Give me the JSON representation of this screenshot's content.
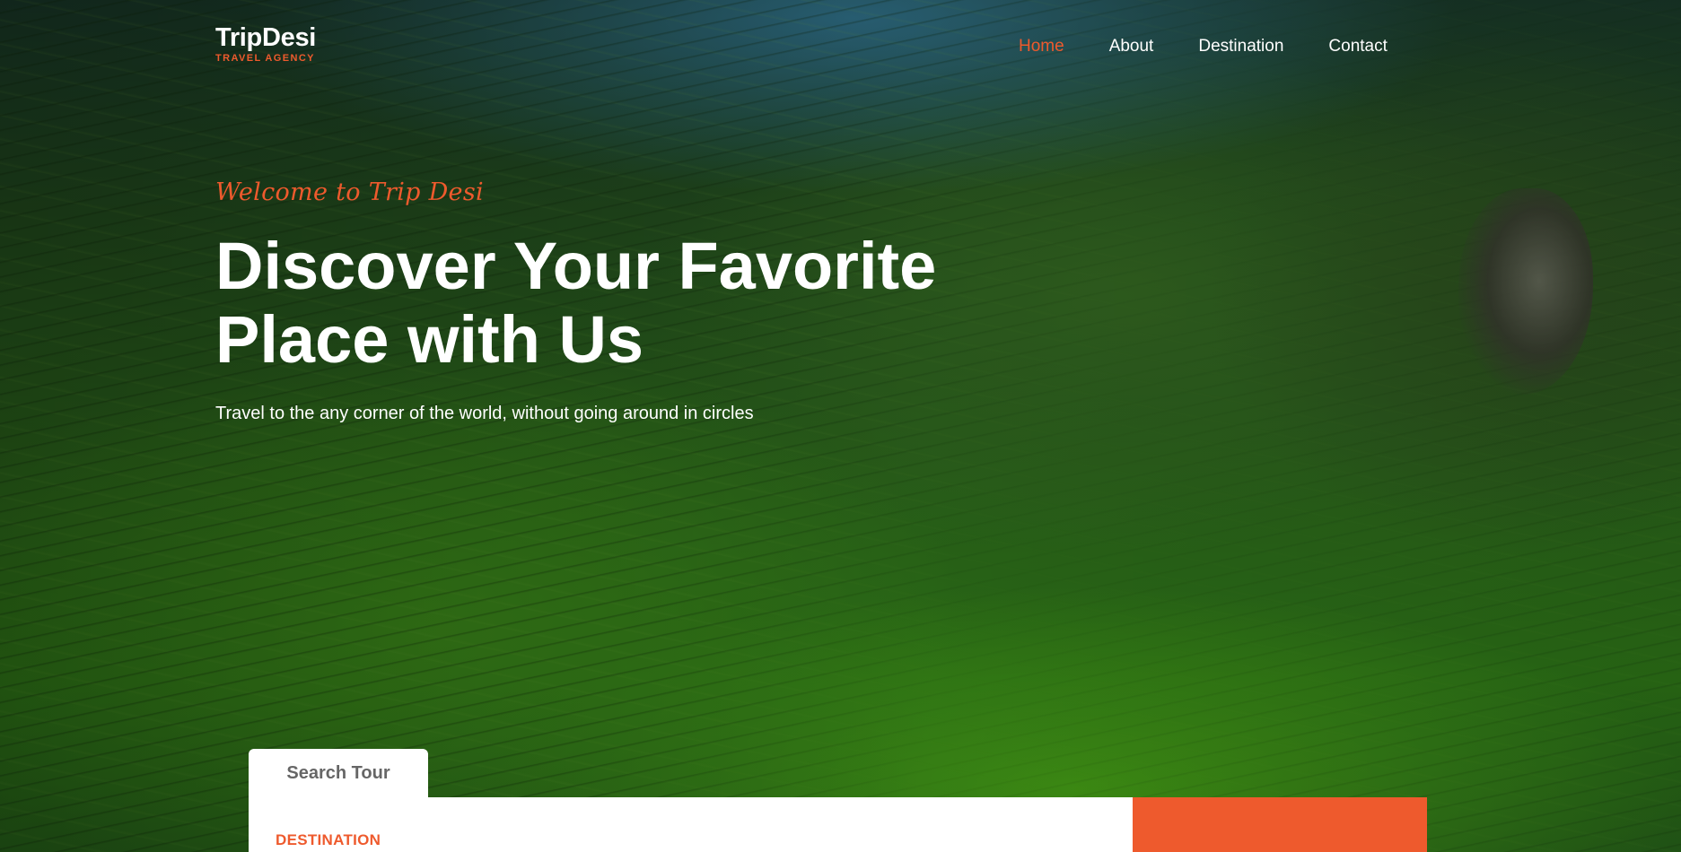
{
  "brand": {
    "name": "TripDesi",
    "tagline": "TRAVEL AGENCY"
  },
  "nav": {
    "items": [
      {
        "label": "Home",
        "active": true
      },
      {
        "label": "About",
        "active": false
      },
      {
        "label": "Destination",
        "active": false
      },
      {
        "label": "Contact",
        "active": false
      }
    ]
  },
  "hero": {
    "welcome": "Welcome to Trip Desi",
    "title_line1": "Discover Your Favorite",
    "title_line2": "Place with Us",
    "subtitle": "Travel to the any corner of the world, without going around in circles"
  },
  "search": {
    "tab_label": "Search Tour",
    "destination_label": "DESTINATION"
  },
  "colors": {
    "accent": "#ee5a2d",
    "text_light": "#ffffff",
    "panel": "#ffffff",
    "tab_text": "#666666"
  }
}
